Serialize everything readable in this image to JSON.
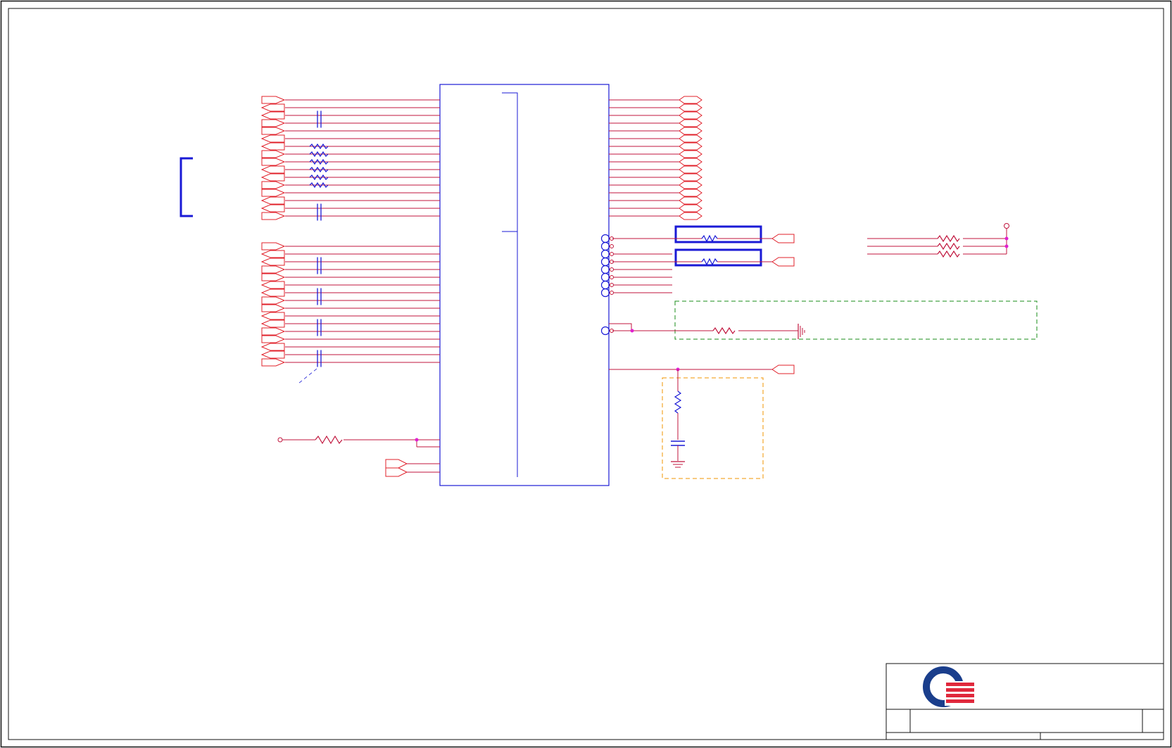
{
  "colors": {
    "border": "#111111",
    "wire": "#c0143c",
    "wire_dark": "#8a1a3c",
    "port": "#e0202a",
    "component": "#1a1ad6",
    "junction": "#e020d0",
    "green_box": "#1a8c1a",
    "orange_box": "#f29400",
    "logo_blue": "#1a3e8c",
    "logo_red": "#e0283c"
  },
  "icons": {
    "logo": "company-logo-icon",
    "resistor": "resistor-icon",
    "capacitor": "capacitor-icon",
    "ground": "ground-icon",
    "connector_pin": "connector-pin-icon",
    "port": "offpage-port-icon"
  },
  "title_block": {
    "logo_alt": "company logo"
  }
}
